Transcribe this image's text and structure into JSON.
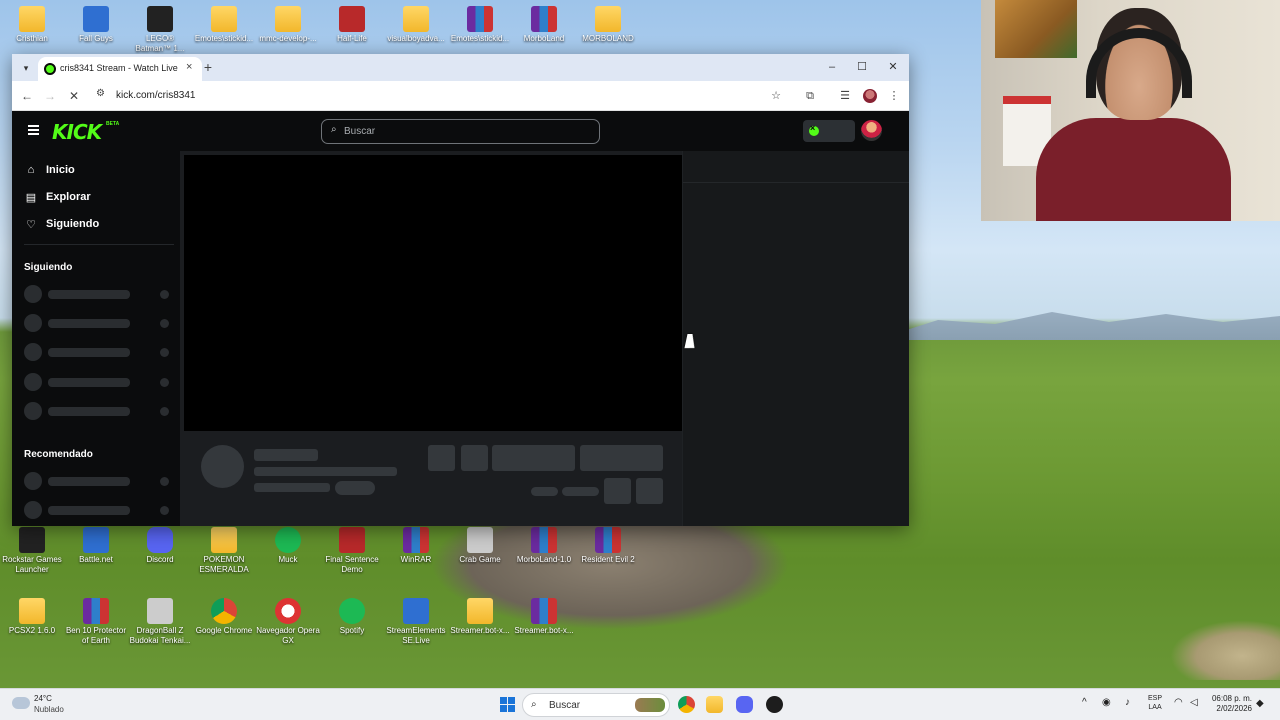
{
  "desktop": {
    "icons_top": [
      {
        "label": "Cristhian",
        "kind": "folder"
      },
      {
        "label": "Fall Guys",
        "kind": "app-blue"
      },
      {
        "label": "LEGO® Batman™ 1...",
        "kind": "app-dark"
      },
      {
        "label": "Emotes\\stickid...",
        "kind": "folder"
      },
      {
        "label": "mmc-develop-...",
        "kind": "folder"
      },
      {
        "label": "Half-Life",
        "kind": "app-red"
      },
      {
        "label": "visualboyadva...",
        "kind": "folder"
      },
      {
        "label": "Emotes\\stickid...",
        "kind": "rar"
      },
      {
        "label": "MorboLand",
        "kind": "rar"
      },
      {
        "label": "MORBOLAND",
        "kind": "folder"
      }
    ],
    "icons_mid": [
      {
        "label": "Rockstar Games Launcher",
        "kind": "app-dark"
      },
      {
        "label": "Battle.net",
        "kind": "app-blue"
      },
      {
        "label": "Discord",
        "kind": "app-discord"
      },
      {
        "label": "POKEMON ESMERALDA",
        "kind": "folder"
      },
      {
        "label": "Muck",
        "kind": "app-green"
      },
      {
        "label": "Final Sentence Demo",
        "kind": "app-red"
      },
      {
        "label": "WinRAR",
        "kind": "rar"
      },
      {
        "label": "Crab Game",
        "kind": "app-gray"
      },
      {
        "label": "MorboLand-1.0",
        "kind": "rar"
      },
      {
        "label": "Resident Evil 2",
        "kind": "rar"
      }
    ],
    "icons_bottom": [
      {
        "label": "PCSX2 1.6.0",
        "kind": "folder"
      },
      {
        "label": "Ben 10 Protector of Earth",
        "kind": "rar"
      },
      {
        "label": "DragonBall Z Budokai Tenkai...",
        "kind": "app-gray"
      },
      {
        "label": "Google Chrome",
        "kind": "app-chrome"
      },
      {
        "label": "Navegador Opera GX",
        "kind": "app-opera"
      },
      {
        "label": "Spotify",
        "kind": "app-green"
      },
      {
        "label": "StreamElements SE.Live",
        "kind": "app-blue"
      },
      {
        "label": "Streamer.bot-x...",
        "kind": "folder"
      },
      {
        "label": "Streamer.bot-x...",
        "kind": "rar"
      }
    ]
  },
  "browser": {
    "tab_title": "cris8341 Stream - Watch Live o",
    "tab_close": "×",
    "new_tab": "+",
    "url": "kick.com/cris8341",
    "controls": {
      "minimize": "–",
      "maximize": "☐",
      "close": "✕"
    },
    "nav": {
      "back": "←",
      "forward": "→",
      "stop": "✕",
      "site_info": "⚙"
    },
    "toolbar_icons": {
      "bookmark": "☆",
      "extensions": "⧉",
      "media": "☰",
      "menu": "⋮"
    }
  },
  "kick": {
    "logo": "KICK",
    "logo_badge": "BETA",
    "search_placeholder": "Buscar",
    "nav_items": [
      {
        "label": "Inicio",
        "icon": "home-icon",
        "glyph": "⌂"
      },
      {
        "label": "Explorar",
        "icon": "browse-icon",
        "glyph": "▤"
      },
      {
        "label": "Siguiendo",
        "icon": "heart-icon",
        "glyph": "♡"
      }
    ],
    "sections": {
      "following": "Siguiendo",
      "recommended": "Recomendado"
    }
  },
  "taskbar": {
    "weather_temp": "24°C",
    "weather_desc": "Nublado",
    "search_label": "Buscar",
    "lang_line1": "ESP",
    "lang_line2": "LAA",
    "time": "06:08 p. m.",
    "date": "2/02/2026",
    "tray_chevron": "^"
  }
}
